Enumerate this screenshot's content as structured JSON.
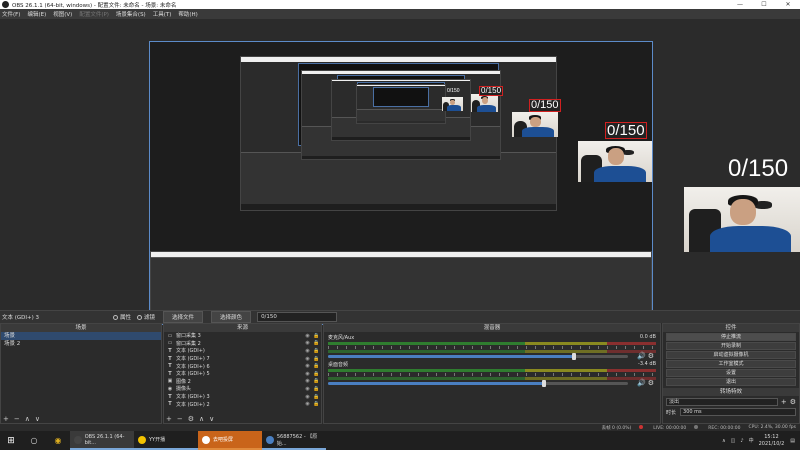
{
  "window": {
    "title": "OBS 26.1.1 (64-bit, windows) - 配置文件: 未命名 - 场景: 未命名"
  },
  "menu": [
    {
      "label": "文件(F)",
      "enabled": true
    },
    {
      "label": "编辑(E)",
      "enabled": true
    },
    {
      "label": "视图(V)",
      "enabled": true
    },
    {
      "label": "配置文件(P)",
      "enabled": false
    },
    {
      "label": "场景集合(S)",
      "enabled": true
    },
    {
      "label": "工具(T)",
      "enabled": true
    },
    {
      "label": "帮助(H)",
      "enabled": true
    }
  ],
  "preview": {
    "counter_text": "0/150",
    "accent_color": "#5c8bc9",
    "counter_border_color": "#d02020"
  },
  "source_bar": {
    "selected_source": "文本 (GDI+) 3",
    "properties_label": "属性",
    "filters_label": "滤镜",
    "select_file_label": "选择文件",
    "select_color_label": "选择颜色",
    "text_value": "0/150"
  },
  "scenes": {
    "header": "场景",
    "items": [
      {
        "label": "场景",
        "selected": true
      },
      {
        "label": "场景 2",
        "selected": false
      }
    ],
    "footer": {
      "add": "+",
      "remove": "−",
      "up": "∧",
      "down": "∨"
    }
  },
  "sources": {
    "header": "来源",
    "items": [
      {
        "icon": "window-capture-icon",
        "glyph": "▭",
        "label": "窗口采集 3"
      },
      {
        "icon": "window-capture-icon",
        "glyph": "▭",
        "label": "窗口采集 2"
      },
      {
        "icon": "text-icon",
        "glyph": "T",
        "label": "文本 (GDI+)"
      },
      {
        "icon": "text-icon",
        "glyph": "T",
        "label": "文本 (GDI+) 7"
      },
      {
        "icon": "text-icon",
        "glyph": "T",
        "label": "文本 (GDI+) 6"
      },
      {
        "icon": "text-icon",
        "glyph": "T",
        "label": "文本 (GDI+) 5"
      },
      {
        "icon": "image-icon",
        "glyph": "▣",
        "label": "图像 2"
      },
      {
        "icon": "camera-icon",
        "glyph": "◉",
        "label": "摄像头"
      },
      {
        "icon": "text-icon",
        "glyph": "T",
        "label": "文本 (GDI+) 3"
      },
      {
        "icon": "text-icon",
        "glyph": "T",
        "label": "文本 (GDI+) 2"
      }
    ],
    "footer": {
      "add": "+",
      "remove": "−",
      "settings": "⚙",
      "up": "∧",
      "down": "∨"
    }
  },
  "mixer": {
    "header": "混音器",
    "channels": [
      {
        "name": "麦克风/Aux",
        "db": "0.0 dB",
        "level": 0.82
      },
      {
        "name": "桌面音频",
        "db": "-3.4 dB",
        "level": 0.72
      }
    ]
  },
  "controls": {
    "header": "控件",
    "buttons": [
      {
        "label": "停止推流",
        "active": true
      },
      {
        "label": "开始录制",
        "active": false
      },
      {
        "label": "启动虚拟摄像机",
        "active": false
      },
      {
        "label": "工作室模式",
        "active": false
      },
      {
        "label": "设置",
        "active": false
      },
      {
        "label": "退出",
        "active": false
      }
    ],
    "transitions_header": "转场特效",
    "transition": "淡出",
    "duration_label": "时长",
    "duration_value": "300 ms"
  },
  "status": {
    "dropped": "丢帧 0 (0.0%)",
    "live": "LIVE: 00:00:00",
    "rec": "REC: 00:00:00",
    "cpu": "CPU: 2.4%, 30.00 fps"
  },
  "taskbar": {
    "tasks": [
      {
        "label": "OBS 26.1.1 (64-bit...",
        "color": "#444",
        "state": "act"
      },
      {
        "label": "YY开播",
        "color": "#f2c200",
        "state": ""
      },
      {
        "label": "去吧投屏",
        "color": "#ffffff",
        "state": "hl"
      },
      {
        "label": "56887562 - 【原始...",
        "color": "#4a7fc1",
        "state": ""
      }
    ],
    "time": "15:12",
    "date": "2021/10/2"
  }
}
